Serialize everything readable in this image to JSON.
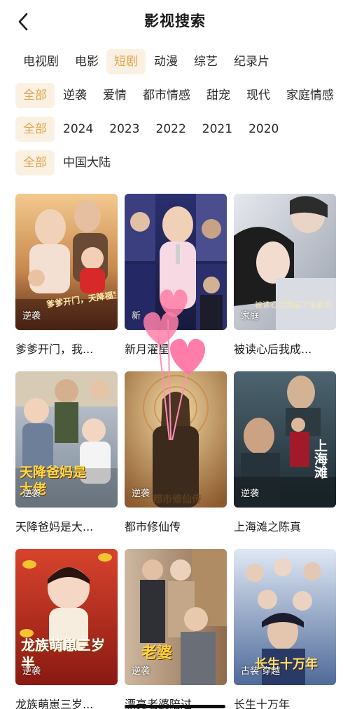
{
  "header": {
    "title": "影视搜索"
  },
  "filters": {
    "category": [
      "电视剧",
      "电影",
      "短剧",
      "动漫",
      "综艺",
      "纪录片"
    ],
    "genre": [
      "全部",
      "逆袭",
      "爱情",
      "都市情感",
      "甜宠",
      "现代",
      "家庭情感"
    ],
    "year": [
      "全部",
      "2024",
      "2023",
      "2022",
      "2021",
      "2020"
    ],
    "region": [
      "全部",
      "中国大陆"
    ]
  },
  "cards": [
    {
      "title": "爹爹开门，我...",
      "badge": "逆袭",
      "overlay": "爹爹开门，天降福宝来救命"
    },
    {
      "title": "新月濯星",
      "badge": "新",
      "overlay": ""
    },
    {
      "title": "被读心后我成...",
      "badge": "家庭",
      "overlay": "被读心后我成了全家的小棉袄"
    },
    {
      "title": "天降爸妈是大...",
      "badge": "逆袭",
      "overlay": "天降爸妈是大佬"
    },
    {
      "title": "都市修仙传",
      "badge": "逆袭",
      "overlay": "都市修仙传"
    },
    {
      "title": "上海滩之陈真",
      "badge": "逆袭",
      "overlay": "上海滩"
    },
    {
      "title": "龙族萌崽三岁...",
      "badge": "逆袭",
      "overlay": "龙族萌崽三岁半"
    },
    {
      "title": "漂亮老婆陪过...",
      "badge": "逆袭",
      "overlay": "老婆"
    },
    {
      "title": "长生十万年",
      "badge": "古装 穿越",
      "overlay": "长生十万年"
    }
  ],
  "colors": {
    "accent": "#e2a44b",
    "accent_bg": "#fbf1e2",
    "balloon": "#ff7fa8"
  }
}
